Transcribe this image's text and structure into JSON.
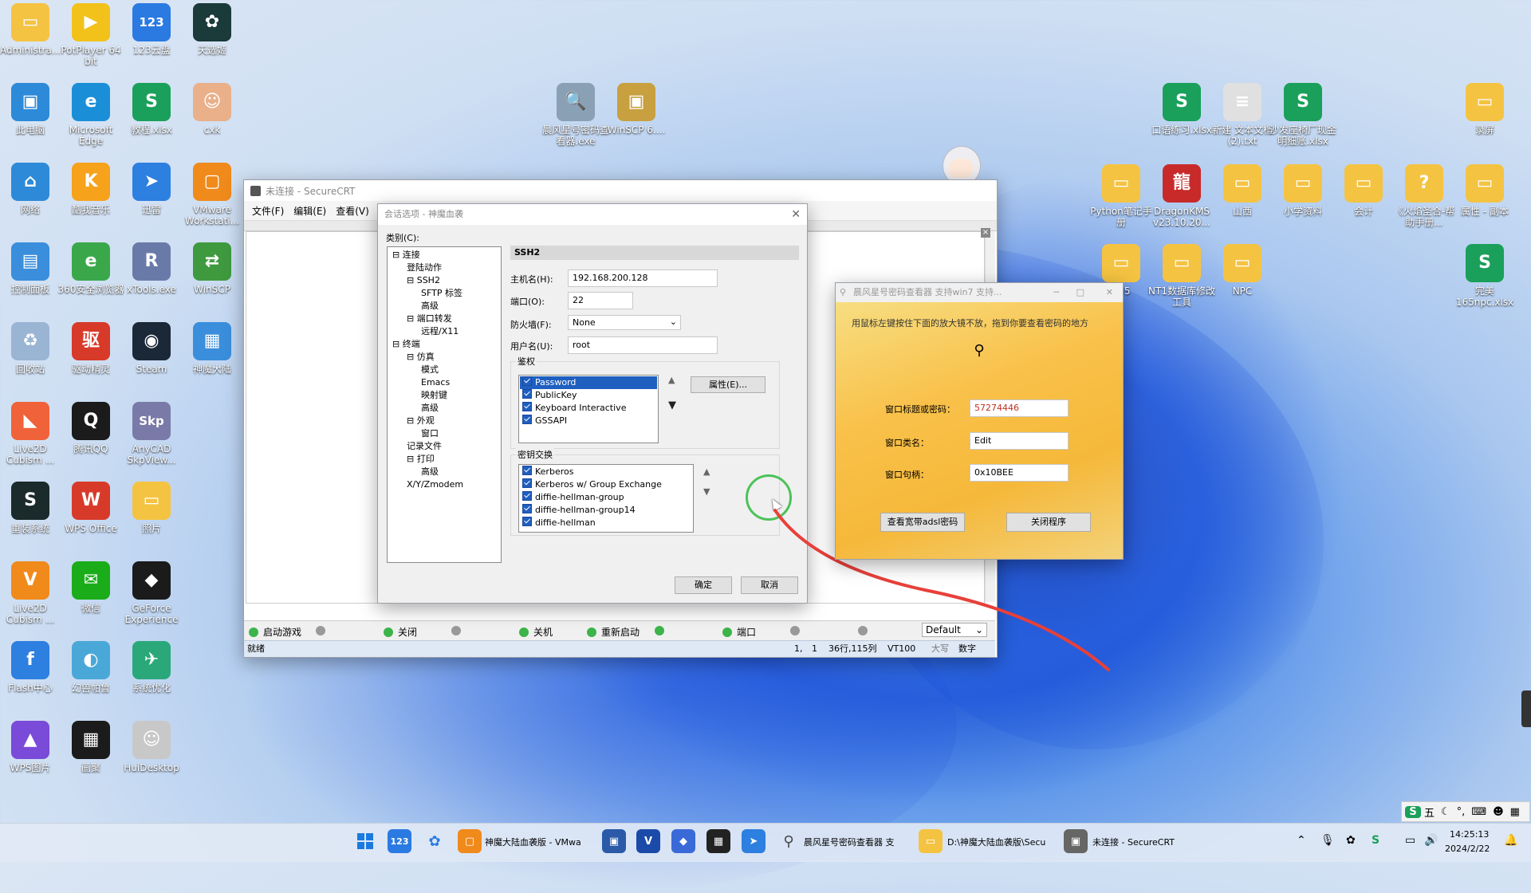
{
  "desktop": {
    "icons_left": [
      {
        "label": "Administra...",
        "color": "#f5c342",
        "glyph": "▭"
      },
      {
        "label": "PotPlayer 64 bit",
        "color": "#f2c21b",
        "glyph": "▶"
      },
      {
        "label": "123云盘",
        "color": "#2a7ae2",
        "glyph": "123"
      },
      {
        "label": "天选姬",
        "color": "#1b3a3a",
        "glyph": "✿"
      },
      {
        "label": "此电脑",
        "color": "#2d8ad8",
        "glyph": "▣"
      },
      {
        "label": "Microsoft Edge",
        "color": "#1a8fd8",
        "glyph": "e"
      },
      {
        "label": "教程.xlsx",
        "color": "#1aa05a",
        "glyph": "S"
      },
      {
        "label": "cxk",
        "color": "#e9b08a",
        "glyph": "☺"
      },
      {
        "label": "网络",
        "color": "#2d8ad8",
        "glyph": "⌂"
      },
      {
        "label": "酷我音乐",
        "color": "#f6a21b",
        "glyph": "K"
      },
      {
        "label": "迅雷",
        "color": "#2d7fe0",
        "glyph": "➤"
      },
      {
        "label": "VMware Workstati...",
        "color": "#f08a1b",
        "glyph": "▢"
      },
      {
        "label": "控制面板",
        "color": "#3a8edc",
        "glyph": "▤"
      },
      {
        "label": "360安全浏览器",
        "color": "#3aa84a",
        "glyph": "e"
      },
      {
        "label": "xTools.exe",
        "color": "#6a7aa8",
        "glyph": "R"
      },
      {
        "label": "WinSCP",
        "color": "#3f9a3f",
        "glyph": "⇄"
      },
      {
        "label": "回收站",
        "color": "#9ab4d4",
        "glyph": "♻"
      },
      {
        "label": "驱动精灵",
        "color": "#d83a2a",
        "glyph": "驱"
      },
      {
        "label": "Steam",
        "color": "#1b2838",
        "glyph": "◉"
      },
      {
        "label": "神魔大陆",
        "color": "#3a8edc",
        "glyph": "▦"
      },
      {
        "label": "Live2D Cubism ...",
        "color": "#f0623a",
        "glyph": "◣"
      },
      {
        "label": "腾讯QQ",
        "color": "#1b1b1b",
        "glyph": "Q"
      },
      {
        "label": "AnyCAD SkpView...",
        "color": "#7a7aa8",
        "glyph": "Skp"
      },
      {
        "label": "",
        "color": "transparent",
        "glyph": ""
      },
      {
        "label": "重装系统",
        "color": "#1b2a2a",
        "glyph": "S"
      },
      {
        "label": "WPS Office",
        "color": "#d83a2a",
        "glyph": "W"
      },
      {
        "label": "照片",
        "color": "#f5c342",
        "glyph": "▭"
      },
      {
        "label": "",
        "color": "transparent",
        "glyph": ""
      },
      {
        "label": "Live2D Cubism ...",
        "color": "#f08a1b",
        "glyph": "V"
      },
      {
        "label": "微信",
        "color": "#1aad19",
        "glyph": "✉"
      },
      {
        "label": "GeForce Experience",
        "color": "#1b1b1b",
        "glyph": "◆"
      },
      {
        "label": "",
        "color": "transparent",
        "glyph": ""
      },
      {
        "label": "Flash中心",
        "color": "#2d7fe0",
        "glyph": "f"
      },
      {
        "label": "幻兽帕鲁",
        "color": "#4aa8d8",
        "glyph": "◐"
      },
      {
        "label": "系统优化",
        "color": "#2aa87a",
        "glyph": "✈"
      },
      {
        "label": "",
        "color": "transparent",
        "glyph": ""
      },
      {
        "label": "WPS图片",
        "color": "#7a4ad8",
        "glyph": "▲"
      },
      {
        "label": "画聚",
        "color": "#1b1b1b",
        "glyph": "▦"
      },
      {
        "label": "HuiDesktop",
        "color": "#c8c8c8",
        "glyph": "☺"
      }
    ],
    "icons_mid": [
      {
        "label": "晨风星号密码查看器.exe",
        "color": "#8aa0b4",
        "glyph": "🔍"
      },
      {
        "label": "WinSCP 6....",
        "color": "#c8a040",
        "glyph": "▣"
      }
    ],
    "icons_right": [
      {
        "label": "口语练习.xlsx",
        "color": "#1aa05a",
        "glyph": "S"
      },
      {
        "label": "新建 文本文档 (2).txt",
        "color": "#e0e0e0",
        "glyph": "≡"
      },
      {
        "label": "沙发座椅厂现金明细账.xlsx",
        "color": "#1aa05a",
        "glyph": "S"
      },
      {
        "label": "录屏",
        "color": "#f5c342",
        "glyph": "▭"
      },
      {
        "label": "Python笔记手册",
        "color": "#f5c342",
        "glyph": "▭"
      },
      {
        "label": "DragonKMS v23.10.20...",
        "color": "#c82a2a",
        "glyph": "龍"
      },
      {
        "label": "山西",
        "color": "#f5c342",
        "glyph": "▭"
      },
      {
        "label": "小学资料",
        "color": "#f5c342",
        "glyph": "▭"
      },
      {
        "label": "会计",
        "color": "#f5c342",
        "glyph": "▭"
      },
      {
        "label": "《火焰圣合-帮助手册...",
        "color": "#f5c342",
        "glyph": "?"
      },
      {
        "label": "属性 - 副本",
        "color": "#f5c342",
        "glyph": "▭"
      },
      {
        "label": "165",
        "color": "#f5c342",
        "glyph": "▭"
      },
      {
        "label": "NT1数据库修改工具",
        "color": "#f5c342",
        "glyph": "▭"
      },
      {
        "label": "NPC",
        "color": "#f5c342",
        "glyph": "▭"
      },
      {
        "label": "完美165npc.xlsx",
        "color": "#1aa05a",
        "glyph": "S"
      }
    ]
  },
  "securecrt": {
    "title": "未连接 - SecureCRT",
    "menu": [
      "文件(F)",
      "编辑(E)",
      "查看(V)"
    ],
    "buttons_bar": [
      "启动游戏",
      "关闭",
      "关机",
      "重新启动",
      "端口"
    ],
    "default_select": "Default",
    "status": {
      "ready": "就绪",
      "pos1": "1,",
      "pos2": "1",
      "rowcol": "36行,115列",
      "term": "VT100",
      "caps": "大写",
      "num": "数字"
    }
  },
  "session_dialog": {
    "title": "会话选项 - 神魔血袭",
    "category_label": "类别(C):",
    "tree": [
      {
        "text": "连接",
        "level": 0,
        "exp": "⊟"
      },
      {
        "text": "登陆动作",
        "level": 1,
        "exp": ""
      },
      {
        "text": "SSH2",
        "level": 1,
        "exp": "⊟"
      },
      {
        "text": "SFTP 标签",
        "level": 2,
        "exp": ""
      },
      {
        "text": "高级",
        "level": 2,
        "exp": ""
      },
      {
        "text": "端口转发",
        "level": 1,
        "exp": "⊟"
      },
      {
        "text": "远程/X11",
        "level": 2,
        "exp": ""
      },
      {
        "text": "终端",
        "level": 0,
        "exp": "⊟"
      },
      {
        "text": "仿真",
        "level": 1,
        "exp": "⊟"
      },
      {
        "text": "模式",
        "level": 2,
        "exp": ""
      },
      {
        "text": "Emacs",
        "level": 2,
        "exp": ""
      },
      {
        "text": "映射键",
        "level": 2,
        "exp": ""
      },
      {
        "text": "高级",
        "level": 2,
        "exp": ""
      },
      {
        "text": "外观",
        "level": 1,
        "exp": "⊟"
      },
      {
        "text": "窗口",
        "level": 2,
        "exp": ""
      },
      {
        "text": "记录文件",
        "level": 1,
        "exp": ""
      },
      {
        "text": "打印",
        "level": 1,
        "exp": "⊟"
      },
      {
        "text": "高级",
        "level": 2,
        "exp": ""
      },
      {
        "text": "X/Y/Zmodem",
        "level": 1,
        "exp": ""
      }
    ],
    "section": "SSH2",
    "hostname_label": "主机名(H):",
    "hostname": "192.168.200.128",
    "port_label": "端口(O):",
    "port": "22",
    "firewall_label": "防火墙(F):",
    "firewall": "None",
    "username_label": "用户名(U):",
    "username": "root",
    "auth_label": "鉴权",
    "auth_items": [
      "Password",
      "PublicKey",
      "Keyboard Interactive",
      "GSSAPI"
    ],
    "properties_btn": "属性(E)...",
    "kex_label": "密钥交换",
    "kex_items": [
      "Kerberos",
      "Kerberos w/ Group Exchange",
      "diffie-hellman-group",
      "diffie-hellman-group14",
      "diffie-hellman"
    ],
    "ok": "确定",
    "cancel": "取消"
  },
  "pw_viewer": {
    "title": "晨风星号密码查看器 支持win7 支持...",
    "hint": "用鼠标左键按住下面的放大镜不放，拖到你要查看密码的地方",
    "pw_label": "窗口标题或密码：",
    "pw_value": "57274446",
    "class_label": "窗口类名：",
    "class_value": "Edit",
    "handle_label": "窗口句柄：",
    "handle_value": "0x10BEE",
    "btn_view": "查看宽带adsl密码",
    "btn_close": "关闭程序"
  },
  "taskbar": {
    "items": [
      {
        "label": "神魔大陆血袭版 - VMwa"
      },
      {
        "label": "晨风星号密码查看器 支"
      },
      {
        "label": "D:\\神魔大陆血袭版\\Secu"
      },
      {
        "label": "未连接 - SecureCRT"
      }
    ],
    "time": "14:25:13",
    "date": "2024/2/22",
    "ime": "五"
  }
}
